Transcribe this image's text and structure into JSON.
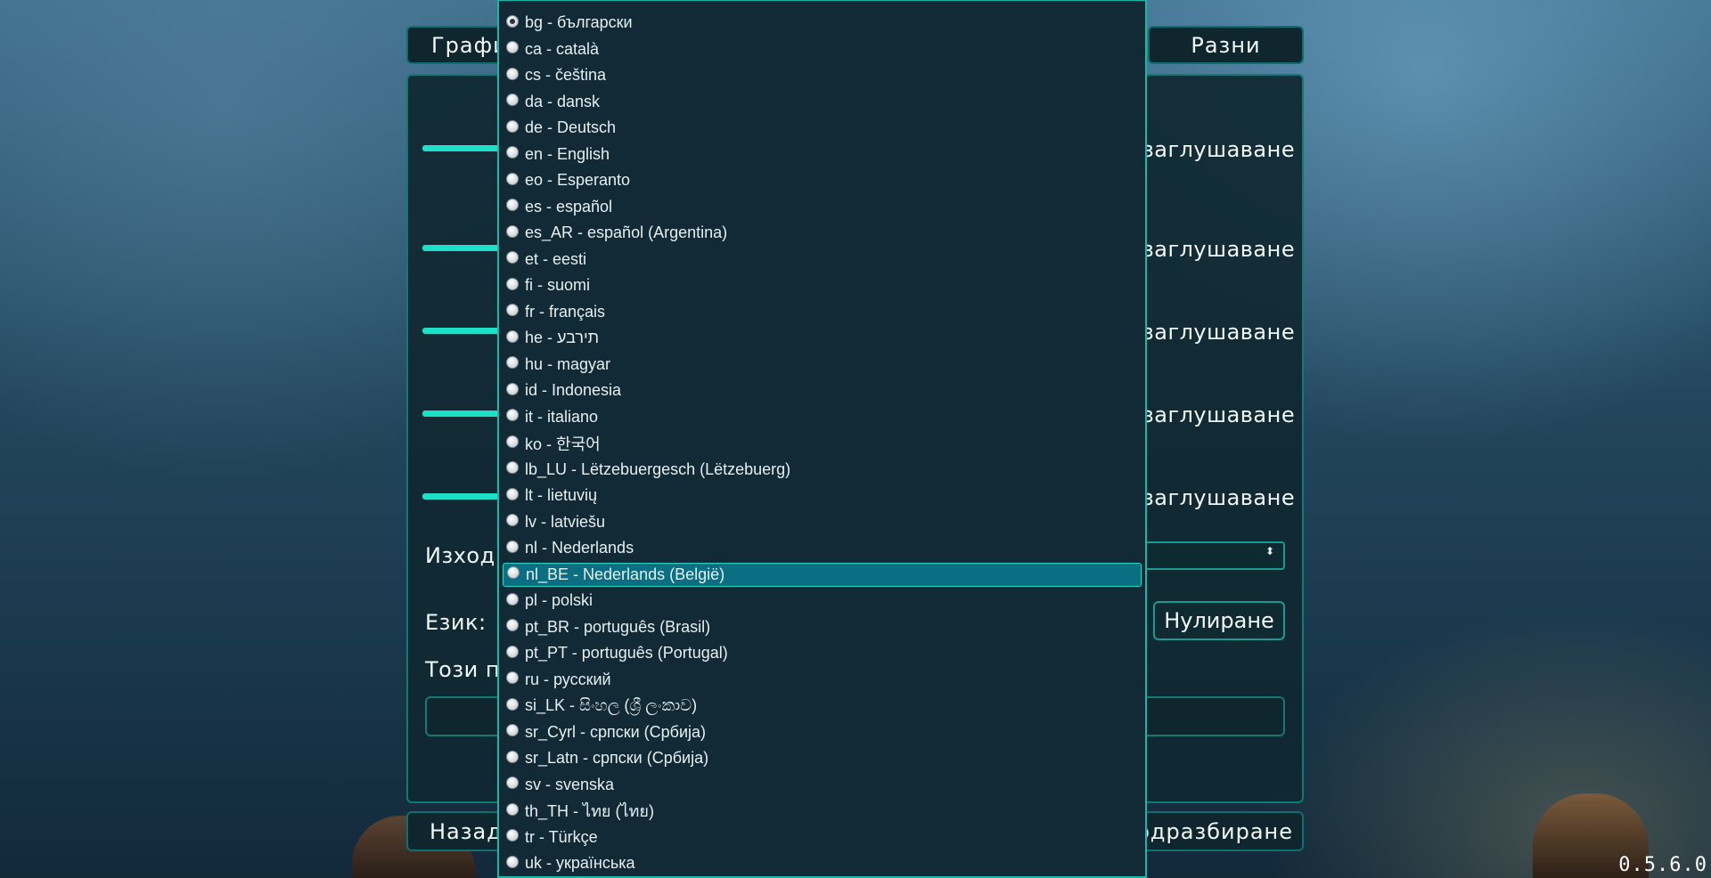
{
  "top_tabs": {
    "left_label": "Графи",
    "right_label": "Разни"
  },
  "settings": {
    "mute_label": "заглушаване",
    "output_label": "Изход",
    "language_label": "Език:",
    "note_label": "Този п",
    "reset_label": "Нулиране",
    "select_arrows": "⬍"
  },
  "bottom_buttons": {
    "back_label": "Назад",
    "defaults_label": "одразбиране"
  },
  "language_dropdown": {
    "items": [
      {
        "label": "bg - български",
        "checked": true
      },
      {
        "label": "ca - català"
      },
      {
        "label": "cs - čeština"
      },
      {
        "label": "da - dansk"
      },
      {
        "label": "de - Deutsch"
      },
      {
        "label": "en - English"
      },
      {
        "label": "eo - Esperanto"
      },
      {
        "label": "es - español"
      },
      {
        "label": "es_AR - español (Argentina)"
      },
      {
        "label": "et - eesti"
      },
      {
        "label": "fi - suomi"
      },
      {
        "label": "fr - français"
      },
      {
        "label": "he - תירבע"
      },
      {
        "label": "hu - magyar"
      },
      {
        "label": "id - Indonesia"
      },
      {
        "label": "it - italiano"
      },
      {
        "label": "ko - 한국어"
      },
      {
        "label": "lb_LU - Lëtzebuergesch (Lëtzebuerg)"
      },
      {
        "label": "lt - lietuvių"
      },
      {
        "label": "lv - latviešu"
      },
      {
        "label": "nl - Nederlands"
      },
      {
        "label": "nl_BE - Nederlands (België)",
        "highlighted": true
      },
      {
        "label": "pl - polski"
      },
      {
        "label": "pt_BR - português (Brasil)"
      },
      {
        "label": "pt_PT - português (Portugal)"
      },
      {
        "label": "ru - русский"
      },
      {
        "label": "si_LK - සිංහල (ශ්‍රී ලංකාව)"
      },
      {
        "label": "sr_Cyrl - српски (Србија)"
      },
      {
        "label": "sr_Latn - српски (Србија)"
      },
      {
        "label": "sv - svenska"
      },
      {
        "label": "th_TH - ไทย (ไทย)"
      },
      {
        "label": "tr - Türkçe"
      },
      {
        "label": "uk - українська"
      }
    ]
  },
  "version": "0.5.6.0",
  "colors": {
    "accent": "#1de0c8",
    "panel_border": "#0f7a76",
    "highlight": "#0a6f82"
  }
}
